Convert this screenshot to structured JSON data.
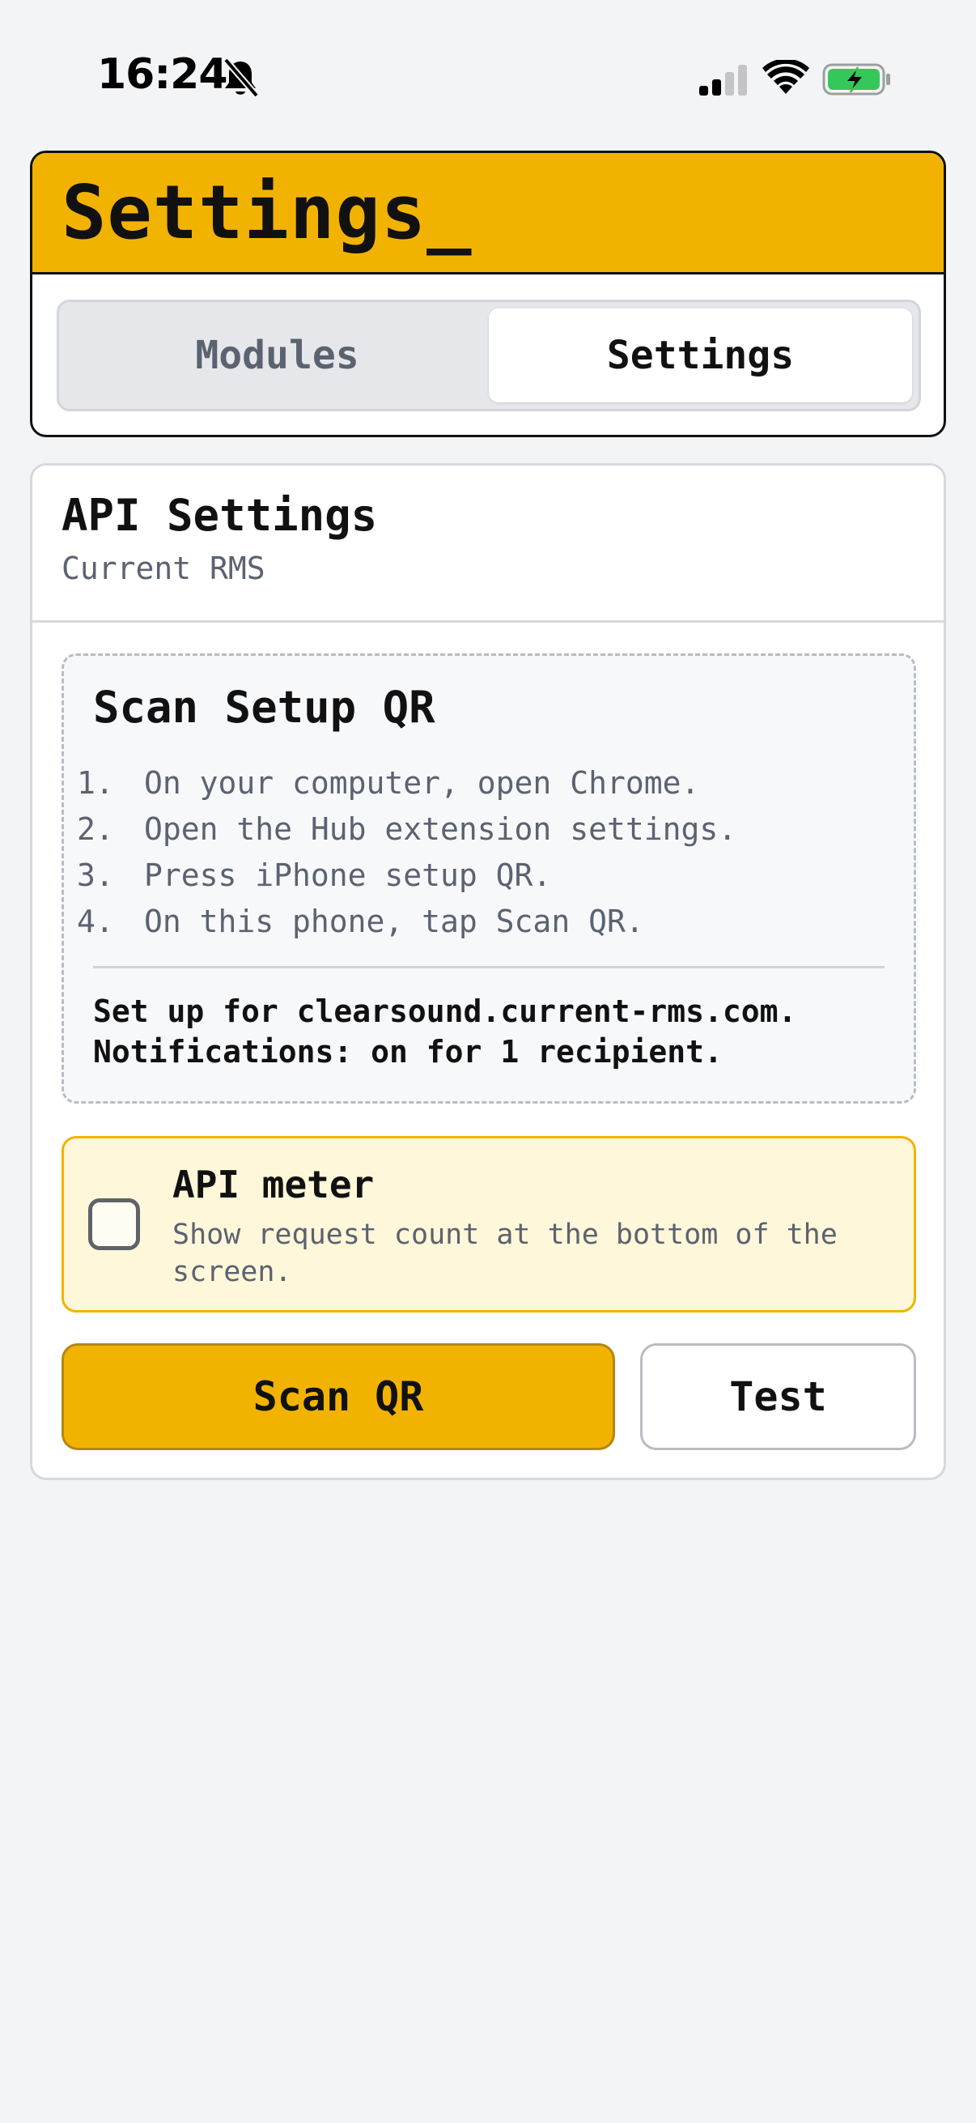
{
  "status_bar": {
    "time": "16:24",
    "icons": [
      "bell-slash-icon",
      "cellular-signal-icon",
      "wifi-icon",
      "battery-charging-icon"
    ],
    "battery_color": "#34c759"
  },
  "header": {
    "title": "Settings",
    "cursor": "_",
    "accent_color": "#f2b300",
    "tabs": [
      {
        "label": "Modules",
        "active": false
      },
      {
        "label": "Settings",
        "active": true
      }
    ]
  },
  "api_settings": {
    "title": "API Settings",
    "subtitle": "Current RMS",
    "scan_setup": {
      "title": "Scan Setup QR",
      "steps": [
        {
          "num": "1.",
          "text": "On your computer, open Chrome."
        },
        {
          "num": "2.",
          "text": "Open the Hub extension settings."
        },
        {
          "num": "3.",
          "text": "Press iPhone setup QR."
        },
        {
          "num": "4.",
          "text": "On this phone, tap Scan QR."
        }
      ],
      "status_line_1": "Set up for clearsound.current-rms.com.",
      "status_line_2": "Notifications: on for 1 recipient."
    },
    "api_meter": {
      "title": "API meter",
      "description": "Show request count at the bottom of the screen.",
      "checked": false
    },
    "buttons": {
      "scan_label": "Scan QR",
      "test_label": "Test"
    }
  }
}
